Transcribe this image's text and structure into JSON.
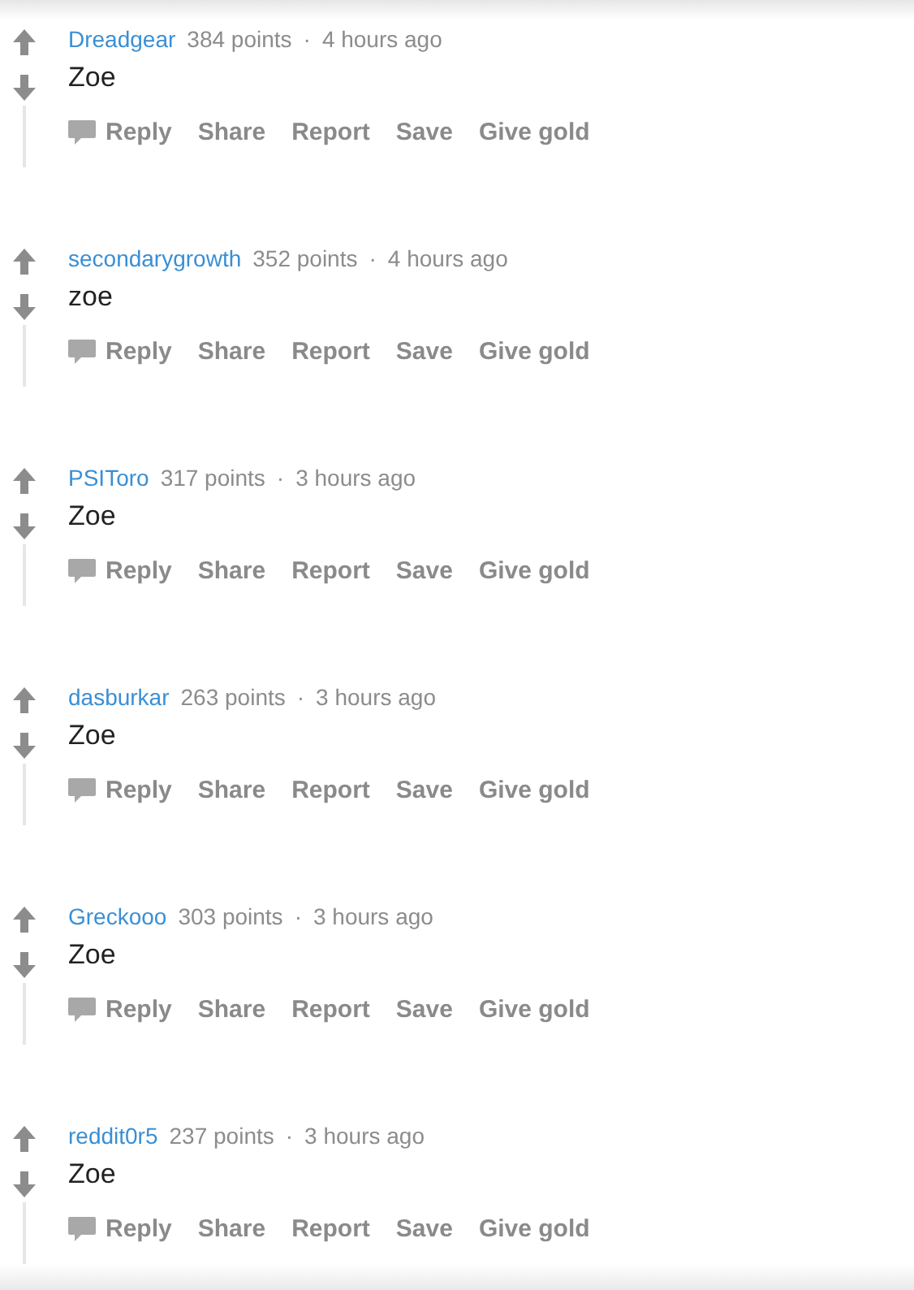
{
  "comments": [
    {
      "author": "Dreadgear",
      "points": "384 points",
      "separator": "·",
      "time": "4 hours ago",
      "body": "Zoe",
      "actions": [
        "Reply",
        "Share",
        "Report",
        "Save",
        "Give gold"
      ]
    },
    {
      "author": "secondarygrowth",
      "points": "352 points",
      "separator": "·",
      "time": "4 hours ago",
      "body": "zoe",
      "actions": [
        "Reply",
        "Share",
        "Report",
        "Save",
        "Give gold"
      ]
    },
    {
      "author": "PSIToro",
      "points": "317 points",
      "separator": "·",
      "time": "3 hours ago",
      "body": "Zoe",
      "actions": [
        "Reply",
        "Share",
        "Report",
        "Save",
        "Give gold"
      ]
    },
    {
      "author": "dasburkar",
      "points": "263 points",
      "separator": "·",
      "time": "3 hours ago",
      "body": "Zoe",
      "actions": [
        "Reply",
        "Share",
        "Report",
        "Save",
        "Give gold"
      ]
    },
    {
      "author": "Greckooo",
      "points": "303 points",
      "separator": "·",
      "time": "3 hours ago",
      "body": "Zoe",
      "actions": [
        "Reply",
        "Share",
        "Report",
        "Save",
        "Give gold"
      ]
    },
    {
      "author": "reddit0r5",
      "points": "237 points",
      "separator": "·",
      "time": "3 hours ago",
      "body": "Zoe",
      "actions": [
        "Reply",
        "Share",
        "Report",
        "Save",
        "Give gold"
      ]
    }
  ]
}
